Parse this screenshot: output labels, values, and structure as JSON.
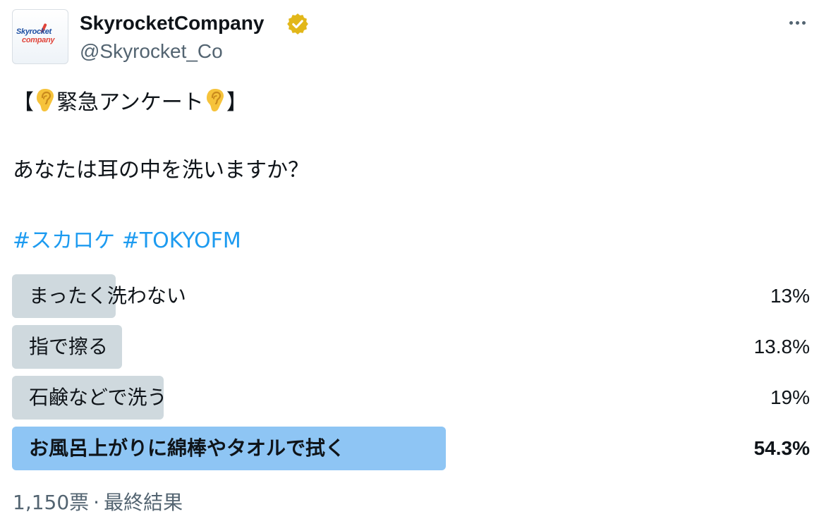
{
  "author": {
    "display_name": "SkyrocketCompany",
    "handle": "@Skyrocket_Co",
    "avatar_text_top": "Skyrocket",
    "avatar_text_bottom": "company",
    "verified": true,
    "verified_badge_color": "#e2b719"
  },
  "tweet": {
    "bracket_open": "【",
    "title": "緊急アンケート",
    "bracket_close": "】",
    "title_emoji": "ear-emoji",
    "question": "あなたは耳の中を洗いますか？",
    "hashtags": [
      "#スカロケ",
      "#TOKYOFM"
    ]
  },
  "poll": {
    "options": [
      {
        "label": "まったく洗わない",
        "percent_text": "13%",
        "percent": 13,
        "winner": false
      },
      {
        "label": "指で擦る",
        "percent_text": "13.8%",
        "percent": 13.8,
        "winner": false
      },
      {
        "label": "石鹸などで洗う",
        "percent_text": "19%",
        "percent": 19,
        "winner": false
      },
      {
        "label": "お風呂上がりに綿棒やタオルで拭く",
        "percent_text": "54.3%",
        "percent": 54.3,
        "winner": true
      }
    ],
    "votes": "1,150票",
    "separator": "·",
    "status": "最終結果"
  },
  "colors": {
    "text": "#0f1419",
    "secondary": "#536471",
    "link": "#1d9bf0",
    "bar": "#cfd9de",
    "winner_bar": "#8ec5f4"
  },
  "icons": {
    "more": "more-horizontal-icon",
    "verified": "verified-badge-icon"
  }
}
